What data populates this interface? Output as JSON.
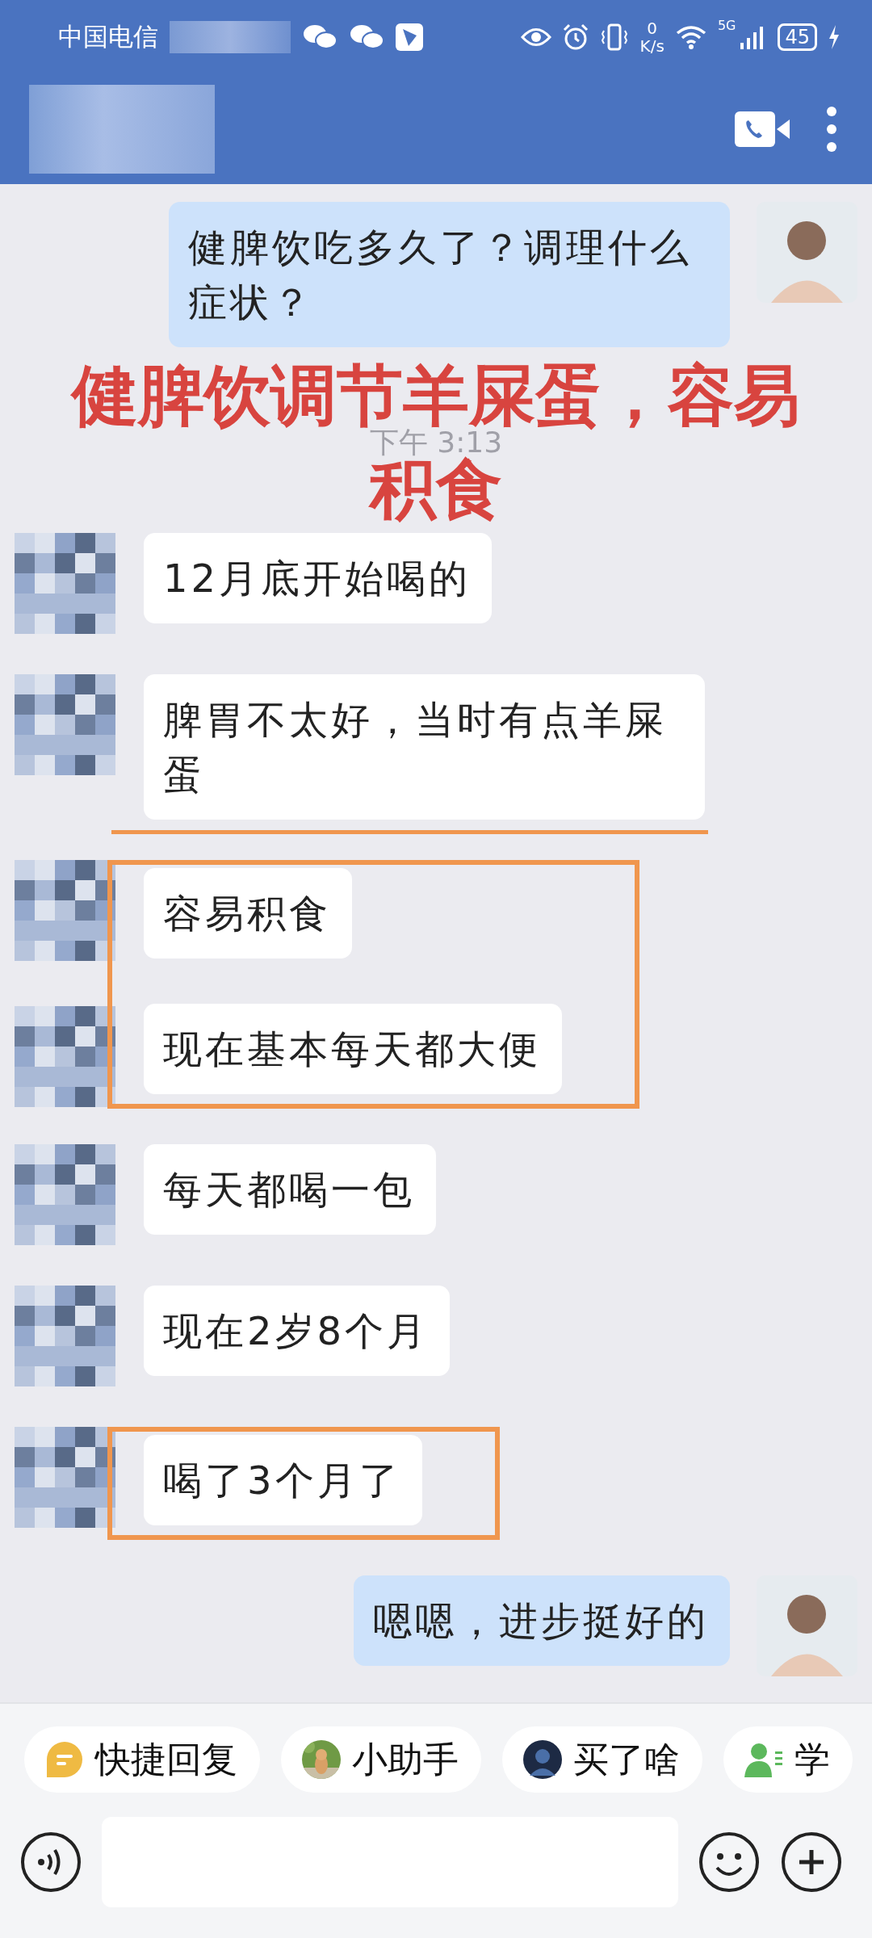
{
  "status_bar": {
    "carrier": "中国电信",
    "speed_value": "0",
    "speed_unit": "K/s",
    "network": "5G",
    "battery": "45"
  },
  "annotation_title": [
    "健脾饮调节羊屎蛋，容易",
    "积食"
  ],
  "chat": [
    {
      "kind": "outgoing",
      "text": "健脾饮吃多久了？调理什么症状？",
      "underlined": false
    },
    {
      "kind": "time",
      "text": "下午 3:13"
    },
    {
      "kind": "incoming",
      "text": "12月底开始喝的",
      "underlined": false
    },
    {
      "kind": "incoming",
      "text": "脾胃不太好，当时有点羊屎蛋",
      "underlined": true
    },
    {
      "kind": "boxed",
      "children": [
        {
          "kind": "incoming",
          "text": "容易积食",
          "underlined": false
        },
        {
          "kind": "incoming",
          "text": "现在基本每天都大便",
          "underlined": false
        }
      ]
    },
    {
      "kind": "incoming",
      "text": "每天都喝一包",
      "underlined": false
    },
    {
      "kind": "incoming",
      "text": "现在2岁8个月",
      "underlined": false
    },
    {
      "kind": "boxed",
      "children": [
        {
          "kind": "incoming",
          "text": "喝了3个月了",
          "underlined": false
        }
      ]
    },
    {
      "kind": "outgoing",
      "text": "嗯嗯，进步挺好的",
      "underlined": false
    }
  ],
  "chips": [
    {
      "kind": "quick-reply",
      "label": "快捷回复"
    },
    {
      "label": "小助手"
    },
    {
      "kind": "avatar",
      "label": "买了啥"
    },
    {
      "kind": "student",
      "label": "学"
    }
  ]
}
